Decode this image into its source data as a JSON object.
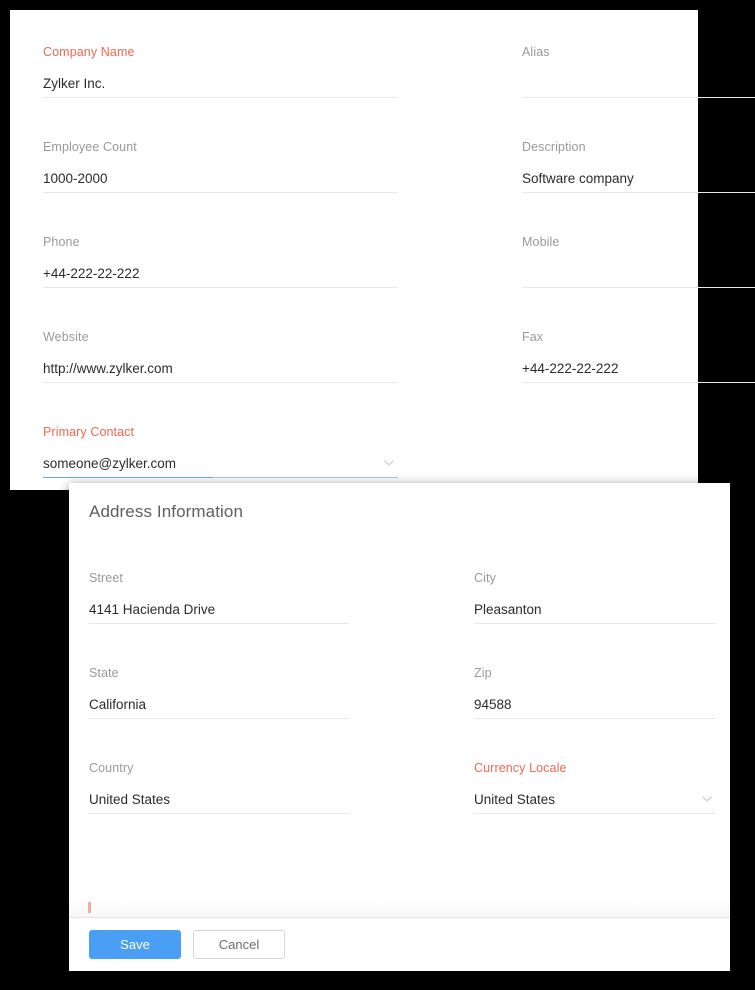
{
  "company_panel": {
    "fields": [
      {
        "label": "Company Name",
        "value": "Zylker Inc.",
        "required": true,
        "column": "left",
        "row": 1,
        "control": "text",
        "focused": false
      },
      {
        "label": "Alias",
        "value": "",
        "required": false,
        "column": "right",
        "row": 1,
        "control": "text",
        "focused": false
      },
      {
        "label": "Employee Count",
        "value": "1000-2000",
        "required": false,
        "column": "left",
        "row": 2,
        "control": "text",
        "focused": false
      },
      {
        "label": "Description",
        "value": "Software company",
        "required": false,
        "column": "right",
        "row": 2,
        "control": "text",
        "focused": false
      },
      {
        "label": "Phone",
        "value": "+44-222-22-222",
        "required": false,
        "column": "left",
        "row": 3,
        "control": "text",
        "focused": false
      },
      {
        "label": "Mobile",
        "value": "",
        "required": false,
        "column": "right",
        "row": 3,
        "control": "text",
        "focused": false
      },
      {
        "label": "Website",
        "value": "http://www.zylker.com",
        "required": false,
        "column": "left",
        "row": 4,
        "control": "text",
        "focused": false
      },
      {
        "label": "Fax",
        "value": "+44-222-22-222",
        "required": false,
        "column": "right",
        "row": 4,
        "control": "text",
        "focused": false
      },
      {
        "label": "Primary Contact",
        "value": "someone@zylker.com",
        "required": true,
        "column": "left",
        "row": 5,
        "control": "select",
        "focused": true
      }
    ]
  },
  "address_panel": {
    "title": "Address Information",
    "fields": [
      {
        "label": "Street",
        "value": "4141 Hacienda Drive",
        "required": false,
        "column": "left",
        "row": 1,
        "control": "text",
        "focused": false
      },
      {
        "label": "City",
        "value": "Pleasanton",
        "required": false,
        "column": "right",
        "row": 1,
        "control": "text",
        "focused": false
      },
      {
        "label": "State",
        "value": "California",
        "required": false,
        "column": "left",
        "row": 2,
        "control": "text",
        "focused": false
      },
      {
        "label": "Zip",
        "value": "94588",
        "required": false,
        "column": "right",
        "row": 2,
        "control": "text",
        "focused": false
      },
      {
        "label": "Country",
        "value": "United States",
        "required": false,
        "column": "left",
        "row": 3,
        "control": "text",
        "focused": false
      },
      {
        "label": "Currency Locale",
        "value": "United States",
        "required": true,
        "column": "right",
        "row": 3,
        "control": "select",
        "focused": false
      }
    ],
    "footer": {
      "save_label": "Save",
      "cancel_label": "Cancel"
    }
  },
  "icons": {
    "chevron_down": "chevron-down-icon"
  },
  "colors": {
    "required_label": "#f2674f",
    "label": "#9a9a9a",
    "value": "#2b2b2b",
    "underline": "#e8e8e8",
    "underline_focus": "#6aa9e0",
    "primary_button": "#4a9ff5",
    "secondary_button_border": "#d6d6d6",
    "panel_background": "#ffffff",
    "page_background": "#000000"
  }
}
